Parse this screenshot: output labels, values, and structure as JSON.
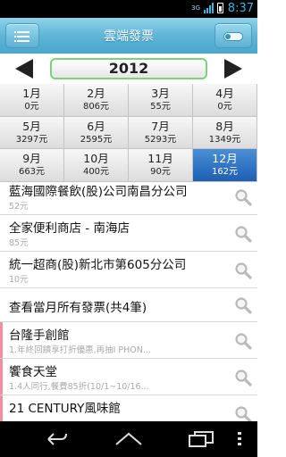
{
  "status_bar": {
    "network": "3G",
    "time": "8:37"
  },
  "header": {
    "title": "雲端發票",
    "menu_icon": "list-menu-icon",
    "toggle_icon": "toggle-switch-icon"
  },
  "year_selector": {
    "year": "2012",
    "prev_icon": "triangle-left-icon",
    "next_icon": "triangle-right-icon"
  },
  "months": [
    {
      "label": "1月",
      "amount": "0元"
    },
    {
      "label": "2月",
      "amount": "806元"
    },
    {
      "label": "3月",
      "amount": "55元"
    },
    {
      "label": "4月",
      "amount": "0元"
    },
    {
      "label": "5月",
      "amount": "3297元"
    },
    {
      "label": "6月",
      "amount": "2595元"
    },
    {
      "label": "7月",
      "amount": "5293元"
    },
    {
      "label": "8月",
      "amount": "1349元"
    },
    {
      "label": "9月",
      "amount": "663元"
    },
    {
      "label": "10月",
      "amount": "400元"
    },
    {
      "label": "11月",
      "amount": "90元"
    },
    {
      "label": "12月",
      "amount": "162元",
      "selected": true
    }
  ],
  "invoices": [
    {
      "name": "藍海國際餐飲(股)公司南昌分公司",
      "detail": "52元"
    },
    {
      "name": "全家便利商店 - 南海店",
      "detail": "85元"
    },
    {
      "name": "統一超商(股)新北市第605分公司",
      "detail": "10元"
    }
  ],
  "view_all": {
    "label": "查看當月所有發票(共4筆)"
  },
  "promotions": [
    {
      "name": "台隆手創館",
      "detail": "1.年終回饋享打折優惠,再抽I PHON..."
    },
    {
      "name": "饗食天堂",
      "detail": "1.4人同行,餐費85折(10/1~10/16..."
    },
    {
      "name": "21 CENTURY風味館",
      "detail": ""
    }
  ],
  "search_icon": "magnifier-icon",
  "colors": {
    "header": "#5fb5d6",
    "selected_month": "#1e5fb3",
    "year_border": "#7fd07a",
    "promo_marker": "#f28ea0"
  },
  "nav_bar": {
    "back_icon": "back-arrow-icon",
    "home_icon": "home-icon",
    "recent_icon": "recent-apps-icon",
    "menu_icon": "overflow-menu-icon"
  }
}
